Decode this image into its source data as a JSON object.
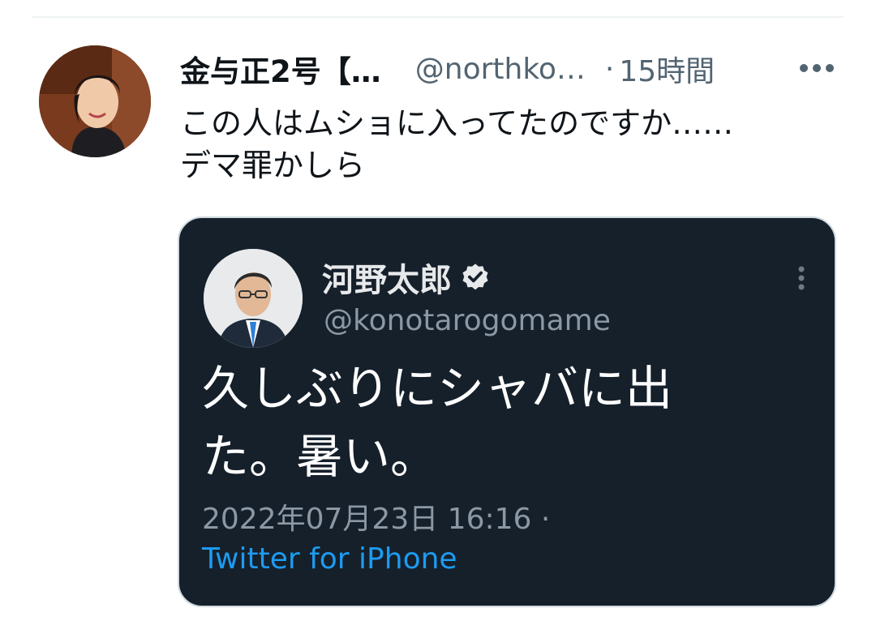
{
  "tweet": {
    "display_name": "金与正2号【…",
    "handle": "@northko…",
    "separator": "·",
    "time": "15時間",
    "text_lines": [
      "この人はムショに入ってたのですか……",
      "デマ罪かしら"
    ]
  },
  "quoted_tweet": {
    "display_name": "河野太郎",
    "handle": "@konotarogomame",
    "text_lines": [
      "久しぶりにシャバに出",
      "た。暑い。"
    ],
    "date": "2022年07月23日 16:16 ·",
    "source": "Twitter for iPhone"
  },
  "icons": {
    "more": "more-horizontal-icon",
    "quote_more": "more-vertical-icon",
    "verified": "verified-badge-icon"
  },
  "colors": {
    "text_primary": "#0f1419",
    "text_secondary": "#536471",
    "quote_bg": "#15202b",
    "link": "#1d9bf0"
  }
}
